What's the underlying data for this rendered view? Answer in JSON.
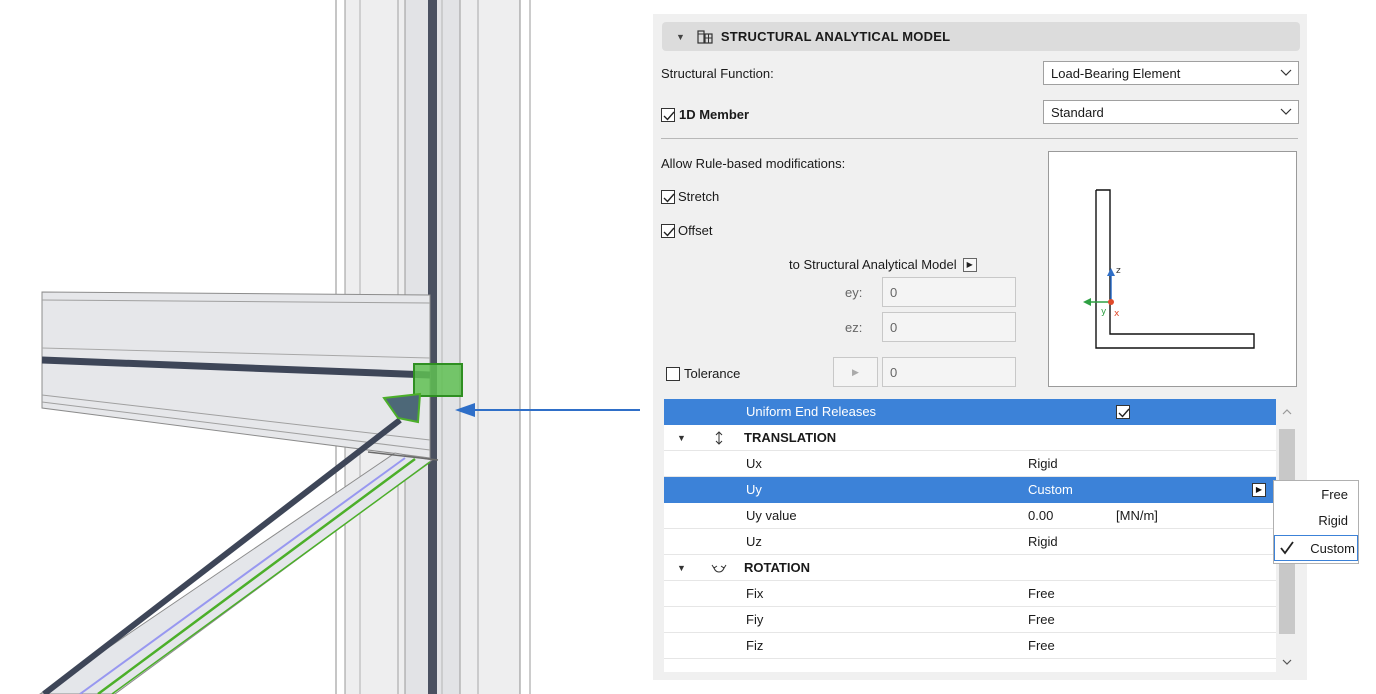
{
  "panel": {
    "title": "STRUCTURAL ANALYTICAL MODEL",
    "structural_function_label": "Structural Function:",
    "structural_function_value": "Load-Bearing Element",
    "member_label": "1D Member",
    "member_checked": true,
    "member_type_value": "Standard",
    "allow_label": "Allow Rule-based modifications:",
    "stretch_label": "Stretch",
    "stretch_checked": true,
    "offset_label": "Offset",
    "offset_checked": true,
    "offset_to_label": "to Structural Analytical Model",
    "ey_label": "ey:",
    "ey_value": "0",
    "ez_label": "ez:",
    "ez_value": "0",
    "tolerance_label": "Tolerance",
    "tolerance_checked": false,
    "tolerance_value": "0",
    "preview_axes": {
      "z": "z",
      "x": "x",
      "y": "y"
    }
  },
  "table": {
    "uniform_label": "Uniform End Releases",
    "uniform_checked": true,
    "translation_label": "TRANSLATION",
    "rotation_label": "ROTATION",
    "rows_translation": [
      {
        "name": "Ux",
        "value": "Rigid",
        "unit": ""
      },
      {
        "name": "Uy",
        "value": "Custom",
        "unit": ""
      },
      {
        "name": "Uy value",
        "value": "0.00",
        "unit": "[MN/m]"
      },
      {
        "name": "Uz",
        "value": "Rigid",
        "unit": ""
      }
    ],
    "rows_rotation": [
      {
        "name": "Fix",
        "value": "Free"
      },
      {
        "name": "Fiy",
        "value": "Free"
      },
      {
        "name": "Fiz",
        "value": "Free"
      }
    ]
  },
  "popup": {
    "options": [
      "Free",
      "Rigid",
      "Custom"
    ],
    "selected": "Custom"
  },
  "colors": {
    "accent": "#3c82d8",
    "member_green": "#4caf2a",
    "axis_z": "#2f6fc8",
    "axis_y": "#2ea043",
    "axis_x": "#e04a2a"
  }
}
